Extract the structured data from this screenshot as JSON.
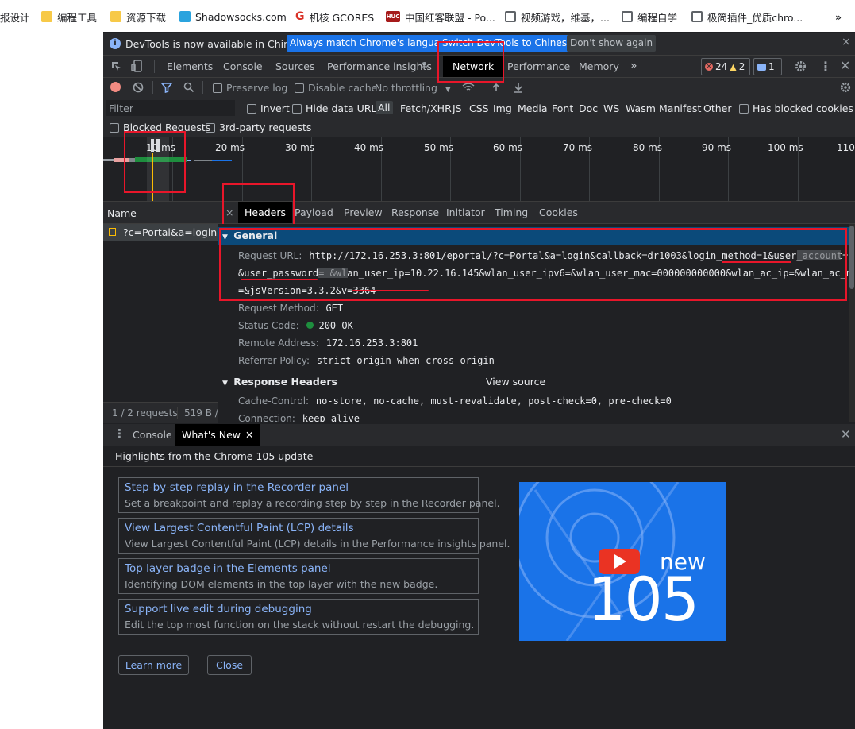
{
  "bookmarks": [
    {
      "label": "报设计",
      "icon": "none"
    },
    {
      "label": "编程工具",
      "icon": "folder-icon"
    },
    {
      "label": "资源下载",
      "icon": "folder-icon"
    },
    {
      "label": "Shadowsocks.com",
      "icon": "telegram-icon"
    },
    {
      "label": "机核 GCORES",
      "icon": "gcores-icon"
    },
    {
      "label": "中国红客联盟 - Po...",
      "icon": "huc-icon"
    },
    {
      "label": "视频游戏，维基，...",
      "icon": "globe-icon"
    },
    {
      "label": "编程自学",
      "icon": "globe-icon"
    },
    {
      "label": "极简插件_优质chro...",
      "icon": "globe-icon"
    },
    {
      "label": "»",
      "icon": "none"
    }
  ],
  "infobar": {
    "message": "DevTools is now available in Chinese!",
    "btn_match": "Always match Chrome's language",
    "btn_switch": "Switch DevTools to Chinese",
    "btn_dont_show": "Don't show again",
    "close": "×"
  },
  "tabs": [
    "Elements",
    "Console",
    "Sources",
    "Performance insights",
    "Network",
    "Performance",
    "Memory",
    "»"
  ],
  "active_tab": "Network",
  "badges": {
    "errors": "24",
    "warnings": "2",
    "messages": "1"
  },
  "net_toolbar": {
    "preserve_log": "Preserve log",
    "disable_cache": "Disable cache",
    "throttling": "No throttling"
  },
  "filter": {
    "placeholder": "Filter",
    "invert": "Invert",
    "hide_data_urls": "Hide data URLs",
    "types": [
      "All",
      "Fetch/XHR",
      "JS",
      "CSS",
      "Img",
      "Media",
      "Font",
      "Doc",
      "WS",
      "Wasm",
      "Manifest",
      "Other"
    ],
    "has_blocked": "Has blocked cookies",
    "blocked_requests": "Blocked Requests",
    "third_party": "3rd-party requests"
  },
  "timeline": {
    "labels": [
      "10 ms",
      "20 ms",
      "30 ms",
      "40 ms",
      "50 ms",
      "60 ms",
      "70 ms",
      "80 ms",
      "90 ms",
      "100 ms",
      "110"
    ]
  },
  "requests": {
    "header": "Name",
    "items": [
      "?c=Portal&a=login..."
    ],
    "footer_count": "1 / 2 requests",
    "footer_size": "519 B /"
  },
  "detail_tabs": [
    "Headers",
    "Payload",
    "Preview",
    "Response",
    "Initiator",
    "Timing",
    "Cookies"
  ],
  "detail_close": "×",
  "general": {
    "title": "General",
    "url_key": "Request URL:",
    "url_line1": "http://172.16.253.3:801/eportal/?c=Portal&a=login&callback=dr1003&login_method=1&user_account=",
    "url_line2": "&user_password=        &wlan_user_ip=10.22.16.145&wlan_user_ipv6=&wlan_user_mac=000000000000&wlan_ac_ip=&wlan_ac_name",
    "url_line3": "=&jsVersion=3.3.2&v=3364",
    "method_key": "Request Method:",
    "method_val": "GET",
    "status_key": "Status Code:",
    "status_val": "200 OK",
    "remote_key": "Remote Address:",
    "remote_val": "172.16.253.3:801",
    "referrer_key": "Referrer Policy:",
    "referrer_val": "strict-origin-when-cross-origin"
  },
  "response_headers": {
    "title": "Response Headers",
    "view_source": "View source",
    "cache_key": "Cache-Control:",
    "cache_val": "no-store, no-cache, must-revalidate, post-check=0, pre-check=0",
    "conn_key": "Connection:",
    "conn_val": "keep-alive"
  },
  "drawer": {
    "tab_console": "Console",
    "tab_whats_new": "What's New",
    "highlights": "Highlights from the Chrome 105 update",
    "cards": [
      {
        "title": "Step-by-step replay in the Recorder panel",
        "desc": "Set a breakpoint and replay a recording step by step in the Recorder panel."
      },
      {
        "title": "View Largest Contentful Paint (LCP) details",
        "desc": "View Largest Contentful Paint (LCP) details in the Performance insights panel."
      },
      {
        "title": "Top layer badge in the Elements panel",
        "desc": "Identifying DOM elements in the top layer with the new badge."
      },
      {
        "title": "Support live edit during debugging",
        "desc": "Edit the top most function on the stack without restart the debugging."
      }
    ],
    "promo_new": "new",
    "promo_version": "105",
    "learn_more": "Learn more",
    "close": "Close"
  },
  "colors": {
    "annotation_red": "#e8162a",
    "accent_blue": "#1a73e8",
    "link_blue": "#8ab4f8",
    "section_blue": "#0b4a7a"
  }
}
